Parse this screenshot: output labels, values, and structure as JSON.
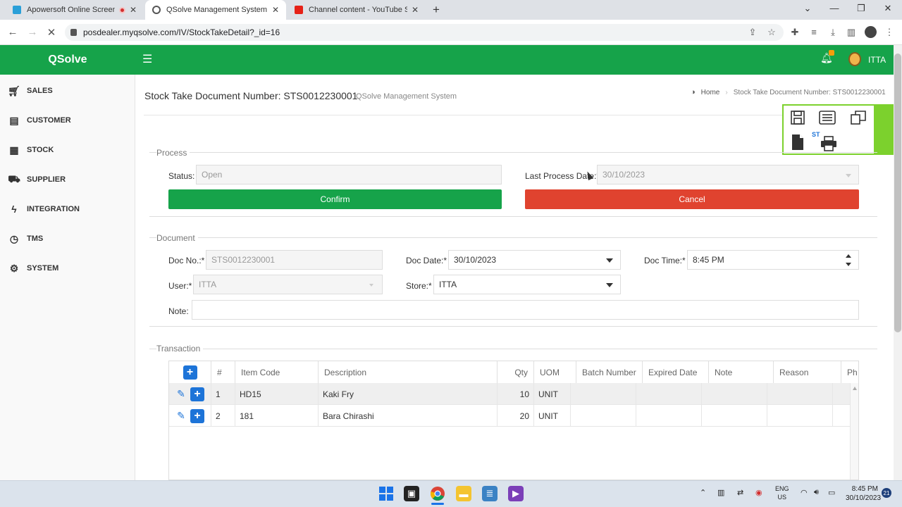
{
  "browser": {
    "tabs": [
      {
        "title": "Apowersoft Online Screen R",
        "active": false
      },
      {
        "title": "QSolve Management System",
        "active": true
      },
      {
        "title": "Channel content - YouTube Stud",
        "active": false
      }
    ],
    "new_tab": "+",
    "url": "posdealer.myqsolve.com/IV/StockTakeDetail?_id=16"
  },
  "app": {
    "brand": "QSolve",
    "user": "ITTA"
  },
  "sidebar": {
    "items": [
      {
        "label": "SALES",
        "icon": "cart-icon"
      },
      {
        "label": "CUSTOMER",
        "icon": "id-card-icon"
      },
      {
        "label": "STOCK",
        "icon": "building-icon"
      },
      {
        "label": "SUPPLIER",
        "icon": "truck-icon"
      },
      {
        "label": "INTEGRATION",
        "icon": "bolt-icon"
      },
      {
        "label": "TMS",
        "icon": "clock-icon"
      },
      {
        "label": "SYSTEM",
        "icon": "gear-icon"
      }
    ]
  },
  "header": {
    "title": "Stock Take Document Number: STS0012230001",
    "subtitle": "QSolve Management System",
    "breadcrumb_home": "Home",
    "breadcrumb_current": "Stock Take Document Number: STS0012230001"
  },
  "process": {
    "legend": "Process",
    "status_label": "Status:",
    "status_value": "Open",
    "last_process_label": "Last Process Date:*",
    "last_process_value": "30/10/2023",
    "confirm_label": "Confirm",
    "cancel_label": "Cancel"
  },
  "document": {
    "legend": "Document",
    "doc_no_label": "Doc No.:*",
    "doc_no_value": "STS0012230001",
    "doc_date_label": "Doc Date:*",
    "doc_date_value": "30/10/2023",
    "doc_time_label": "Doc Time:*",
    "doc_time_value": "8:45 PM",
    "user_label": "User:*",
    "user_value": "ITTA",
    "store_label": "Store:*",
    "store_value": "ITTA",
    "note_label": "Note:",
    "note_value": ""
  },
  "toolbar": {
    "st_label": "ST"
  },
  "transaction": {
    "legend": "Transaction",
    "columns": [
      "#",
      "Item Code",
      "Description",
      "Qty",
      "UOM",
      "Batch Number",
      "Expired Date",
      "Note",
      "Reason",
      "Ph"
    ],
    "rows": [
      {
        "no": "1",
        "item_code": "HD15",
        "description": "Kaki Fry",
        "qty": "10",
        "uom": "UNIT",
        "batch": "",
        "expired": "",
        "note": "",
        "reason": ""
      },
      {
        "no": "2",
        "item_code": "181",
        "description": "Bara Chirashi",
        "qty": "20",
        "uom": "UNIT",
        "batch": "",
        "expired": "",
        "note": "",
        "reason": ""
      }
    ]
  },
  "taskbar": {
    "lang_1": "ENG",
    "lang_2": "US",
    "time": "8:45 PM",
    "date": "30/10/2023",
    "notif_count": "21"
  },
  "colors": {
    "brand_green": "#16a34a",
    "cancel_red": "#e0432f",
    "toolbar_lime": "#7cd12d",
    "action_blue": "#1d74d8"
  }
}
